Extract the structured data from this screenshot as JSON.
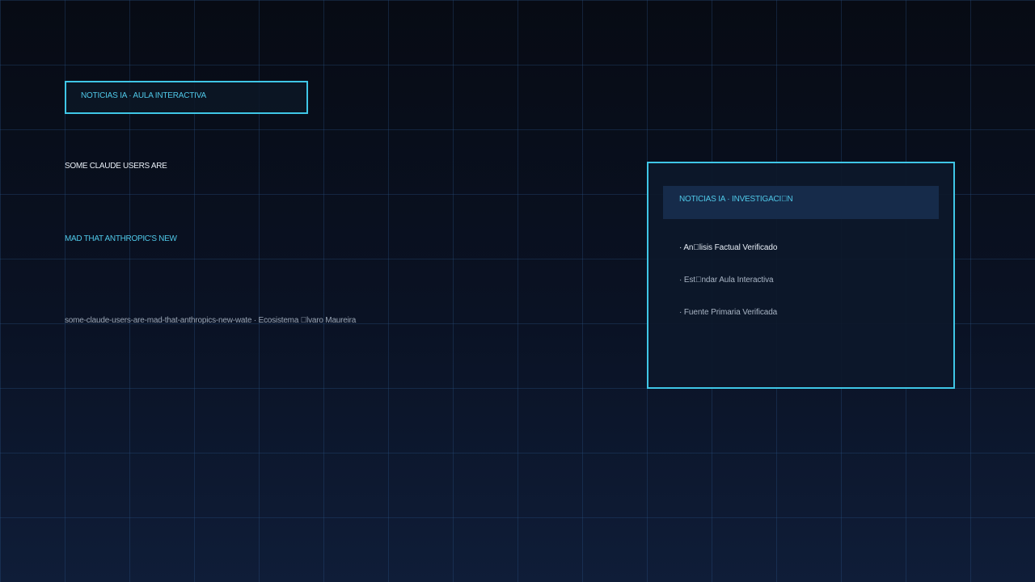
{
  "header_tag": {
    "label": "NOTICIAS IA · AULA INTERACTIVA"
  },
  "article": {
    "headline_line1": "SOME CLAUDE USERS ARE",
    "headline_line2": "MAD THAT ANTHROPIC'S NEW",
    "source": "some-claude-users-are-mad-that-anthropics-new-wate · Ecosistema \u0000lvaro Maureira"
  },
  "side_panel": {
    "title": "NOTICIAS IA · INVESTIGACI\u0000N",
    "items": [
      "· An\u0000lisis Factual Verificado",
      "· Est\u0000ndar Aula Interactiva",
      "· Fuente Primaria Verificada"
    ]
  },
  "colors": {
    "accent": "#3fc6e6",
    "background_top": "#070b14",
    "background_bottom": "#0f1d38",
    "panel_header": "#162b4a",
    "text_primary": "#e8eef6",
    "text_secondary": "#a8b4c4"
  }
}
